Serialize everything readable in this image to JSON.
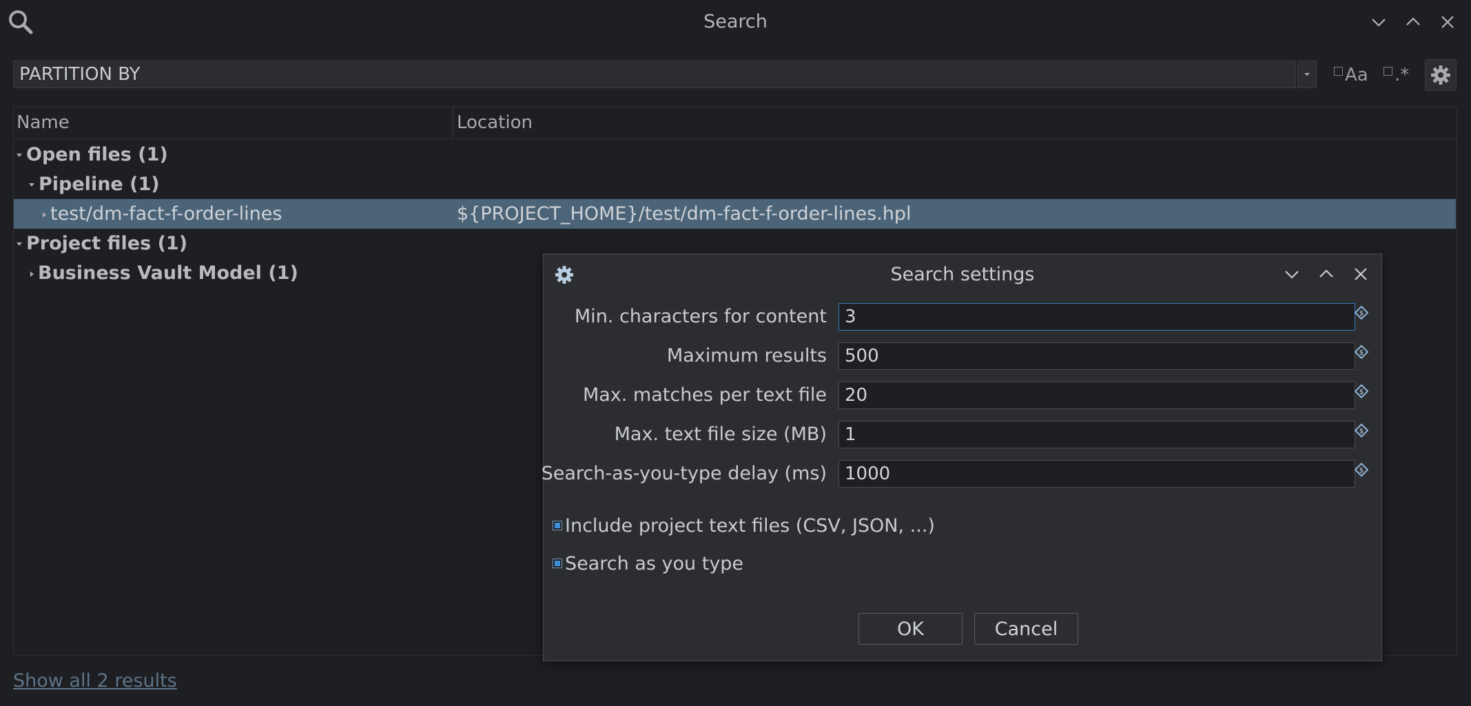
{
  "window": {
    "title": "Search",
    "icons": {
      "search": "search-icon",
      "minimize": "chevron-down-icon",
      "maximize": "chevron-up-icon",
      "close": "close-icon"
    }
  },
  "search": {
    "query": "PARTITION BY",
    "case_sensitive_label": "Aa",
    "case_sensitive_checked": false,
    "regex_label": ".*",
    "regex_checked": false
  },
  "results": {
    "columns": [
      "Name",
      "Location"
    ],
    "rows": [
      {
        "label": "Open files  (1)",
        "location": "",
        "level": 0,
        "expanded": true,
        "bold": true,
        "selected": false
      },
      {
        "label": "Pipeline  (1)",
        "location": "",
        "level": 1,
        "expanded": true,
        "bold": true,
        "selected": false
      },
      {
        "label": "test/dm-fact-f-order-lines",
        "location": "${PROJECT_HOME}/test/dm-fact-f-order-lines.hpl",
        "level": 2,
        "expanded": false,
        "bold": false,
        "selected": true
      },
      {
        "label": "Project files  (1)",
        "location": "",
        "level": 0,
        "expanded": true,
        "bold": true,
        "selected": false
      },
      {
        "label": "Business Vault Model  (1)",
        "location": "",
        "level": 1,
        "expanded": false,
        "bold": true,
        "selected": false
      }
    ],
    "show_all_link": "Show all 2 results"
  },
  "dialog": {
    "title": "Search settings",
    "fields": [
      {
        "label": "Min. characters for content",
        "value": "3"
      },
      {
        "label": "Maximum results",
        "value": "500"
      },
      {
        "label": "Max. matches per text file",
        "value": "20"
      },
      {
        "label": "Max. text file size (MB)",
        "value": "1"
      },
      {
        "label": "Search-as-you-type delay (ms)",
        "value": "1000"
      }
    ],
    "checkboxes": [
      {
        "label": "Include project text files (CSV, JSON, ...)",
        "checked": true
      },
      {
        "label": "Search as you type",
        "checked": true
      }
    ],
    "ok_label": "OK",
    "cancel_label": "Cancel"
  },
  "colors": {
    "background": "#1e1f22",
    "panel": "#2b2d30",
    "selection": "#4b6478",
    "accent": "#3d8fd6"
  }
}
